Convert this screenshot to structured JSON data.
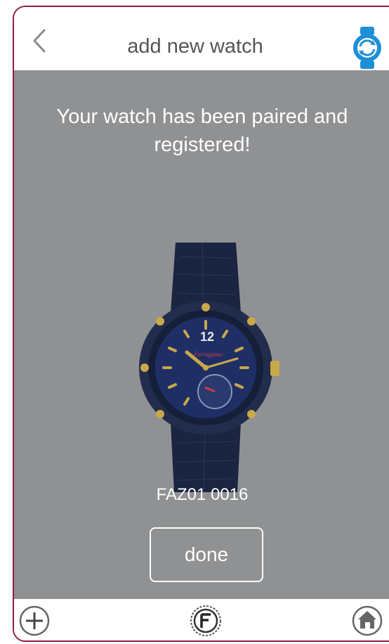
{
  "header": {
    "title": "add new watch",
    "back_icon": "chevron-left-icon",
    "sync_icon": "watch-sync-icon"
  },
  "main": {
    "message": "Your watch has been paired and registered!",
    "watch_image": "watch-image",
    "model_name": "FAZ01 0016",
    "done_label": "done"
  },
  "bottom_bar": {
    "add_icon": "plus-circle-icon",
    "logo_icon": "brand-logo-icon",
    "home_icon": "home-icon"
  },
  "colors": {
    "frame_border": "#8e1f3c",
    "content_bg": "#8f9193",
    "accent_blue": "#1e90d6",
    "watch_navy": "#1f2a4a",
    "gold": "#c9a84a"
  }
}
